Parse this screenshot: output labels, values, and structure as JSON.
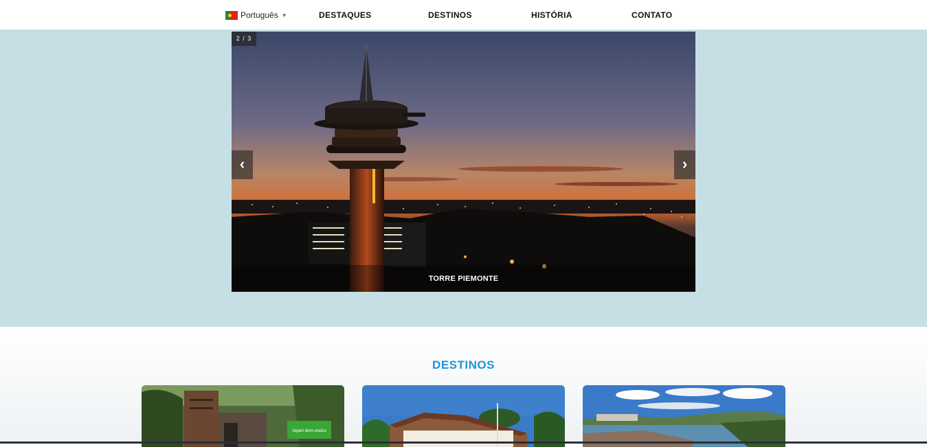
{
  "nav": {
    "language": "Português",
    "items": [
      "DESTAQUES",
      "DESTINOS",
      "HISTÓRIA",
      "CONTATO"
    ]
  },
  "slider": {
    "counter": "2 / 3",
    "caption": "TORRE PIEMONTE",
    "prev_icon": "‹",
    "next_icon": "›"
  },
  "destinos": {
    "title": "DESTINOS",
    "cards": [
      {
        "name": "forest-building",
        "sign_text": "Sejam bem-vindos"
      },
      {
        "name": "house-palms"
      },
      {
        "name": "lake-city"
      }
    ]
  },
  "colors": {
    "hero_bg": "#c6dfe5",
    "accent": "#1c94d6"
  }
}
